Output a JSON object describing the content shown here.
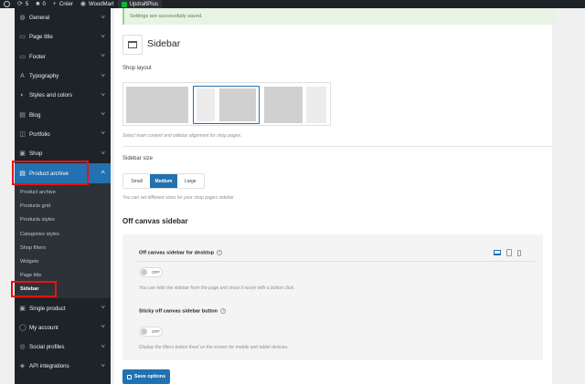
{
  "admin_bar": {
    "updates_count": "5",
    "comments_count": "0",
    "new_label": "Créer",
    "woodmart_label": "WoodMart",
    "updraft_label": "UpdraftPlus"
  },
  "sidebar": {
    "items_top": [
      {
        "label": "General",
        "icon": "globe-icon"
      },
      {
        "label": "Page title",
        "icon": "title-icon"
      },
      {
        "label": "Footer",
        "icon": "footer-icon"
      },
      {
        "label": "Typography",
        "icon": "typography-icon"
      },
      {
        "label": "Styles and colors",
        "icon": "palette-icon"
      },
      {
        "label": "Blog",
        "icon": "blog-icon"
      },
      {
        "label": "Portfolio",
        "icon": "portfolio-icon"
      },
      {
        "label": "Shop",
        "icon": "shop-icon"
      }
    ],
    "current": {
      "label": "Product archive",
      "icon": "archive-icon"
    },
    "submenu": [
      "Product archive",
      "Products grid",
      "Products styles",
      "Categories styles",
      "Shop filters",
      "Widgets",
      "Page title",
      "Sidebar"
    ],
    "items_bottom": [
      {
        "label": "Single product",
        "icon": "product-icon"
      },
      {
        "label": "My account",
        "icon": "user-icon"
      },
      {
        "label": "Social profiles",
        "icon": "share-icon"
      },
      {
        "label": "API integrations",
        "icon": "api-icon"
      }
    ]
  },
  "notice": "Settings are successfully saved.",
  "page_title": "Sidebar",
  "shop_layout": {
    "label": "Shop layout",
    "help": "Select main content and sidebar alignment for shop pages.",
    "selected": "sidebar-left"
  },
  "sidebar_size": {
    "label": "Sidebar size",
    "options": [
      "Small",
      "Medium",
      "Large"
    ],
    "selected": "Medium",
    "help": "You can set different sizes for your shop pages sidebar"
  },
  "off_canvas": {
    "heading": "Off canvas sidebar",
    "desktop_label": "Off canvas sidebar for desktop",
    "desktop_toggle": "OFF",
    "desktop_help": "You can hide the sidebar from the page and show it nicely with a button click.",
    "sticky_label": "Sticky off canvas sidebar button",
    "sticky_toggle": "OFF",
    "sticky_help": "Display the filters button fixed on the screen for mobile and tablet devices.",
    "help_mark": "?"
  },
  "save_label": "Save options",
  "colors": {
    "accent": "#2271b1",
    "admin_dark": "#1d2327",
    "highlight": "#e11111",
    "notice_bg": "#e7f3e5"
  }
}
